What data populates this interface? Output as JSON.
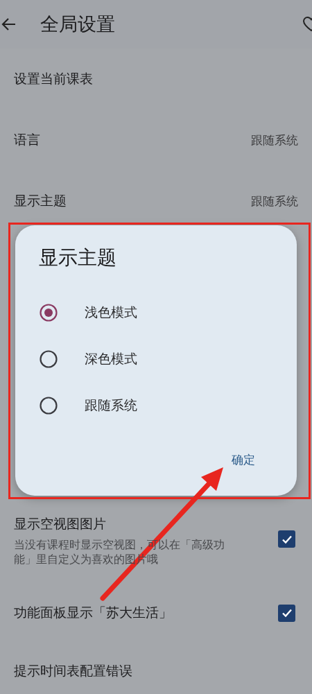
{
  "app_bar": {
    "title": "全局设置"
  },
  "settings": [
    {
      "kind": "link",
      "label": "设置当前课表"
    },
    {
      "kind": "value",
      "label": "语言",
      "value": "跟随系统"
    },
    {
      "kind": "value",
      "label": "显示主题",
      "value": "跟随系统"
    },
    {
      "kind": "checkbox",
      "label": "显示空视图图片",
      "description": "当没有课程时显示空视图，可以在「高级功能」里自定义为喜欢的图片哦",
      "checked": true
    },
    {
      "kind": "checkbox",
      "label": "功能面板显示「苏大生活」",
      "checked": true
    },
    {
      "kind": "link",
      "label": "提示时间表配置错误"
    }
  ],
  "dialog": {
    "title": "显示主题",
    "options": [
      {
        "label": "浅色模式",
        "selected": true
      },
      {
        "label": "深色模式",
        "selected": false
      },
      {
        "label": "跟随系统",
        "selected": false
      }
    ],
    "confirm": "确定"
  }
}
